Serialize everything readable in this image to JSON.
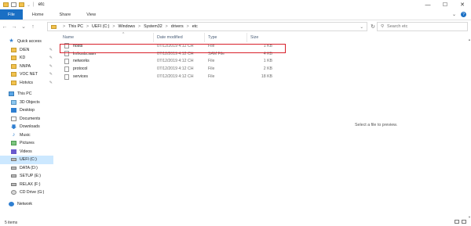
{
  "window": {
    "title": "etc",
    "controls": {
      "minimize": "—",
      "maximize": "☐",
      "close": "✕"
    }
  },
  "ribbon": {
    "tabs": [
      "File",
      "Home",
      "Share",
      "View"
    ],
    "expand_icon": "chevron-down-icon",
    "help_label": "?"
  },
  "address_bar": {
    "crumbs": [
      "This PC",
      "UEFI (C:)",
      "Windows",
      "System32",
      "drivers",
      "etc"
    ],
    "dropdown": "⌄",
    "refresh": "↻"
  },
  "search": {
    "placeholder": "Search etc"
  },
  "sidebar": {
    "quick_access_label": "Quick access",
    "quick_items": [
      {
        "label": "DIEN",
        "pinned": true
      },
      {
        "label": "KD",
        "pinned": true
      },
      {
        "label": "NNPA",
        "pinned": true
      },
      {
        "label": "VOC NET",
        "pinned": true
      },
      {
        "label": "Hotvics",
        "pinned": true
      }
    ],
    "this_pc_label": "This PC",
    "pc_items": [
      "3D Objects",
      "Desktop",
      "Documents",
      "Downloads",
      "Music",
      "Pictures",
      "Videos",
      "UEFI (C:)",
      "DATA (D:)",
      "SETUP (E:)",
      "RELAX (F:)",
      "CD Drive (G:)"
    ],
    "network_label": "Network"
  },
  "file_list": {
    "columns": [
      "Name",
      "Date modified",
      "Type",
      "Size"
    ],
    "rows": [
      {
        "name": "hosts",
        "date": "07/12/2019 4:12 CH",
        "type": "File",
        "size": "1 KB"
      },
      {
        "name": "lmhosts.sam",
        "date": "07/12/2019 4:12 CH",
        "type": "SAM File",
        "size": "4 KB"
      },
      {
        "name": "networks",
        "date": "07/12/2019 4:12 CH",
        "type": "File",
        "size": "1 KB"
      },
      {
        "name": "protocol",
        "date": "07/12/2019 4:12 CH",
        "type": "File",
        "size": "2 KB"
      },
      {
        "name": "services",
        "date": "07/12/2019 4:12 CH",
        "type": "File",
        "size": "18 KB"
      }
    ],
    "highlighted_row": "hosts",
    "highlight_color": "#d8202a"
  },
  "preview": {
    "message": "Select a file to preview."
  },
  "status": {
    "item_count": "5 items"
  },
  "colors": {
    "accent": "#1a6fc4",
    "selection": "#cce8ff",
    "folder": "#f2c14e"
  }
}
